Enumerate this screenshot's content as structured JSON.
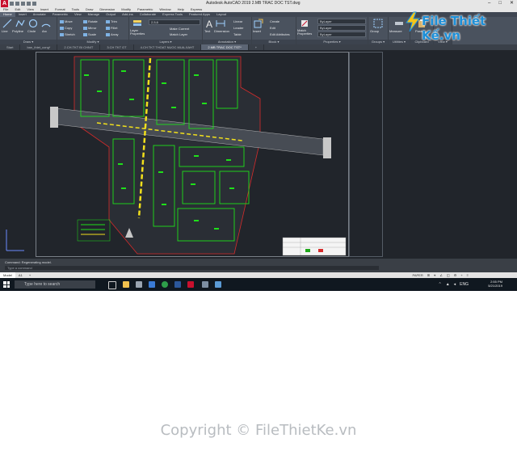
{
  "app": {
    "logo_letter": "A",
    "title": "Autodesk AutoCAD 2019   2.MB TRAC DOC TST.dwg",
    "window_buttons": [
      "–",
      "□",
      "✕"
    ]
  },
  "menu": [
    "File",
    "Edit",
    "View",
    "Insert",
    "Format",
    "Tools",
    "Draw",
    "Dimension",
    "Modify",
    "Parametric",
    "Window",
    "Help",
    "Express"
  ],
  "ribbon_tabs": [
    "Home",
    "Insert",
    "Annotate",
    "Parametric",
    "View",
    "Manage",
    "Output",
    "Add-ins",
    "Collaborate",
    "Express Tools",
    "Featured Apps",
    "Layout"
  ],
  "ribbon": {
    "draw": {
      "tools": [
        "Line",
        "Polyline",
        "Circle",
        "Arc"
      ],
      "label": "Draw ▾"
    },
    "modify": {
      "tools": [
        "Move",
        "Rotate",
        "Trim",
        "Copy",
        "Mirror",
        "Fillet",
        "Stretch",
        "Scale",
        "Array"
      ],
      "label": "Modify ▾"
    },
    "layers": {
      "tool": "Layer Properties",
      "dropdown": "2,5,6",
      "tools": [
        "Make Current",
        "Match Layer"
      ],
      "label": "Layers ▾"
    },
    "annotation": {
      "tools": [
        "Text",
        "Dimension",
        "Linear",
        "Leader",
        "Table"
      ],
      "label": "Annotation ▾"
    },
    "block": {
      "tools": [
        "Insert",
        "Create",
        "Edit",
        "Edit Attributes"
      ],
      "label": "Block ▾"
    },
    "properties": {
      "tool": "Match Properties",
      "dropdowns": [
        "ByLayer",
        "ByLayer",
        "ByLayer"
      ],
      "label": "Properties ▾"
    },
    "groups": {
      "tool": "Group",
      "label": "Groups ▾"
    },
    "utilities": {
      "tool": "Measure",
      "label": "Utilities ▾"
    },
    "clipboard": {
      "tool": "Paste",
      "label": "Clipboard"
    },
    "view": {
      "label": "View ▾"
    }
  },
  "watermark": {
    "text": "File Thiết Kế.vn"
  },
  "doc_tabs": [
    "Start",
    "ban_thiet_cong*",
    "2.CH.TKT BI CHNIT",
    "3.CH TKT GT",
    "4.CH TKT THOAT NUOC MUA-XAHT",
    "2.MB TRAC DOC TST*",
    "+"
  ],
  "command": {
    "history": "Command: Regenerating model.",
    "prompt": "Type a command"
  },
  "layout_tabs": [
    "Model",
    "A1",
    "+"
  ],
  "status_items": [
    "PAPER",
    "⊞",
    "⌖",
    "∠",
    "◫",
    "⚙",
    "+",
    "≡"
  ],
  "taskbar": {
    "search_placeholder": "Type here to search",
    "time": "2:55 PM",
    "date": "5/21/2019",
    "lang": "ENG"
  },
  "copyright": "Copyright © FileThietKe.vn",
  "colors": {
    "canvas": "#21252b",
    "green": "#1fe01a",
    "yellow": "#f2e01c",
    "accent": "#c8102e"
  }
}
